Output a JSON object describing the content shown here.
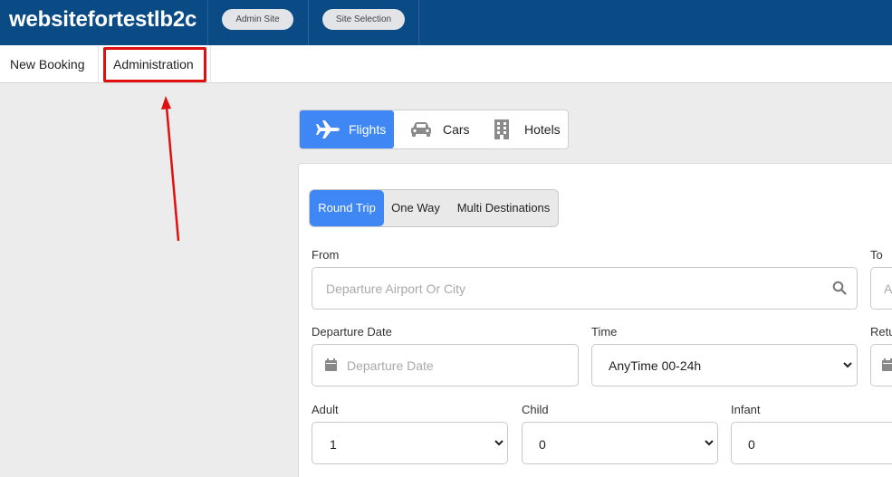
{
  "topbar": {
    "brand": "websitefortestlb2c",
    "admin_site": "Admin Site",
    "site_selection": "Site Selection"
  },
  "nav": {
    "new_booking": "New Booking",
    "administration": "Administration"
  },
  "tabs": [
    {
      "label": "Flights",
      "icon": "plane-icon",
      "active": true
    },
    {
      "label": "Cars",
      "icon": "car-icon",
      "active": false
    },
    {
      "label": "Hotels",
      "icon": "building-icon",
      "active": false
    }
  ],
  "trip_types": [
    {
      "label": "Round Trip",
      "active": true
    },
    {
      "label": "One Way",
      "active": false
    },
    {
      "label": "Multi Destinations",
      "active": false
    }
  ],
  "form": {
    "from_label": "From",
    "from_placeholder": "Departure Airport Or City",
    "to_label": "To",
    "to_placeholder": "A",
    "departure_date_label": "Departure Date",
    "departure_date_placeholder": "Departure Date",
    "time_label": "Time",
    "time_value": "AnyTime 00-24h",
    "return_label": "Retu",
    "adult_label": "Adult",
    "adult_value": "1",
    "child_label": "Child",
    "child_value": "0",
    "infant_label": "Infant",
    "infant_value": "0"
  },
  "colors": {
    "topbar": "#0a4a85",
    "accent": "#3f87f5",
    "highlight": "#e01010"
  }
}
